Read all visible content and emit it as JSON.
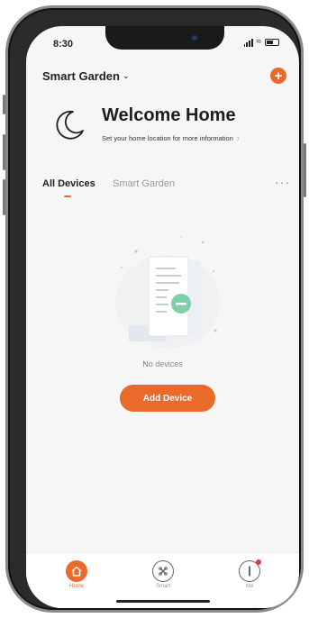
{
  "status_bar": {
    "time": "8:30"
  },
  "header": {
    "home_name": "Smart Garden",
    "add_icon": "plus-icon"
  },
  "welcome": {
    "title": "Welcome Home",
    "subtitle": "Set your home location for more information",
    "icon": "moon-icon"
  },
  "tabs": {
    "items": [
      "All Devices",
      "Smart Garden"
    ],
    "more": "···"
  },
  "empty_state": {
    "text": "No devices",
    "button": "Add Device"
  },
  "bottom_nav": [
    {
      "label": "Home",
      "icon": "home-icon",
      "active": true
    },
    {
      "label": "Smart",
      "icon": "smart-icon",
      "active": false
    },
    {
      "label": "Me",
      "icon": "profile-icon",
      "active": false
    }
  ],
  "colors": {
    "accent": "#ea6a2b",
    "background": "#f6f6f6",
    "illustration_green": "#7fcfab"
  }
}
